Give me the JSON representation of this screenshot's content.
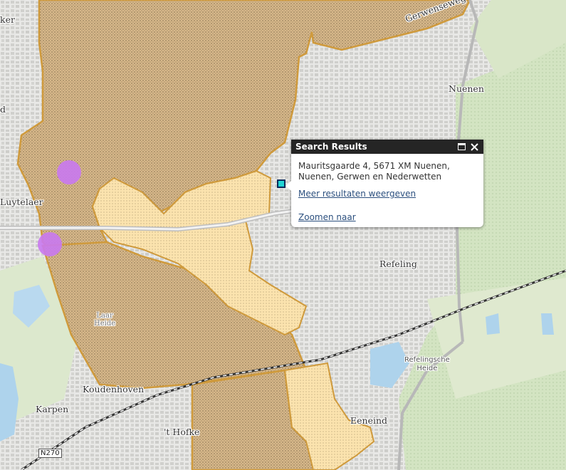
{
  "map": {
    "colors": {
      "base": "#e6e6e3",
      "urban": "#d6d6d3",
      "green": "#d3e4c2",
      "water": "#aed3ec",
      "zone_dark": "#d7b88a",
      "zone_light": "#fbe3ae",
      "zone_border": "#cf9a3c",
      "railway": "#333333",
      "highlight": "#c979f0"
    },
    "labels": {
      "nuenen": "Nuenen",
      "refeling": "Refeling",
      "eeneind": "Eeneind",
      "koudenhoven": "Koudenhoven",
      "karpen": "Karpen",
      "hofke": "'t Hofke",
      "luytelaer": "Luytelaer",
      "gerwenseweg": "Gerwenseweg",
      "refelingse_heide_1": "Refelingsche",
      "refelingse_heide_2": "Heide",
      "laar_1": "Laar",
      "laar_2": "Heide",
      "edge_ker": "ker",
      "edge_d": "d",
      "road_shield": "N270"
    }
  },
  "popup": {
    "title": "Search Results",
    "maximize_icon": "maximize-icon",
    "close_icon": "close-icon",
    "address_line1": "Mauritsgaarde 4, 5671 XM Nuenen,",
    "address_line2": "Nuenen, Gerwen en Nederwetten",
    "more_link": "Meer resultaten weergeven",
    "zoom_link": "Zoomen naar"
  }
}
